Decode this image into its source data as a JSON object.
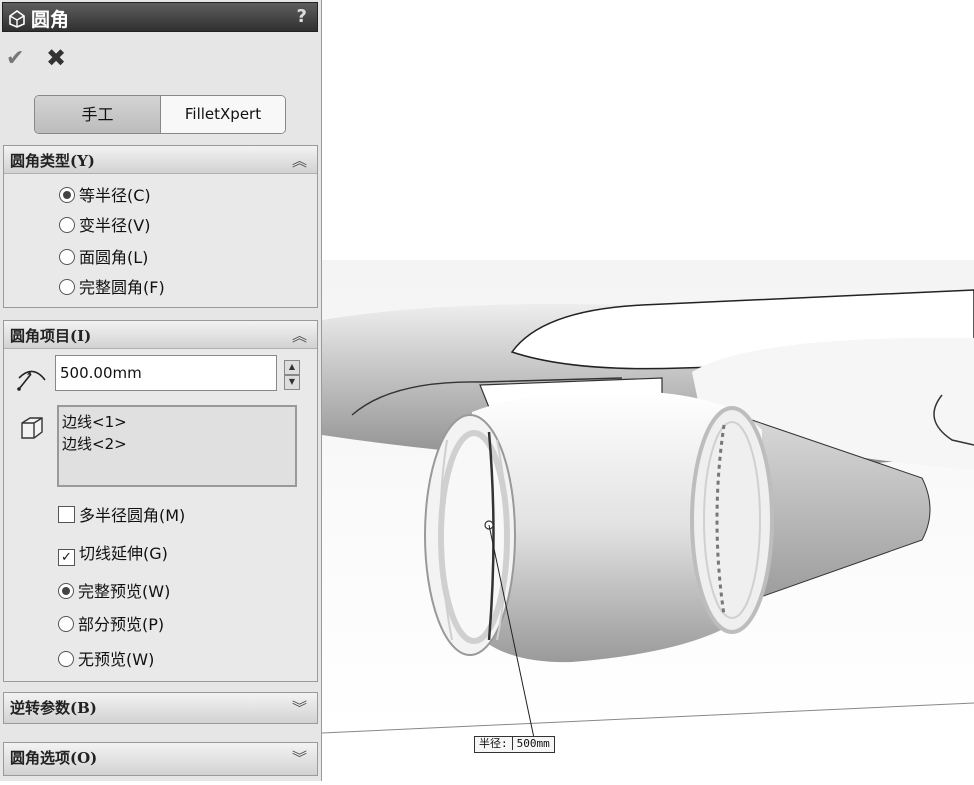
{
  "panel": {
    "title": "圆角",
    "help": "?",
    "tabs": {
      "manual": "手工",
      "filletxpert": "FilletXpert"
    },
    "fillet_type": {
      "header": "圆角类型(Y)",
      "options": [
        "等半径(C)",
        "变半径(V)",
        "面圆角(L)",
        "完整圆角(F)"
      ],
      "selected": 0
    },
    "fillet_items": {
      "header": "圆角项目(I)",
      "radius_value": "500.00mm",
      "edges": [
        "边线<1>",
        "边线<2>"
      ],
      "multi_radius": {
        "label": "多半径圆角(M)",
        "checked": false
      },
      "tangent_propagation": {
        "label": "切线延伸(G)",
        "checked": true
      },
      "preview_options": [
        "完整预览(W)",
        "部分预览(P)",
        "无预览(W)"
      ],
      "preview_selected": 0
    },
    "setback": {
      "header": "逆转参数(B)"
    },
    "fillet_options": {
      "header": "圆角选项(O)"
    }
  },
  "viewport": {
    "callout_label": "半径:",
    "callout_value": "500mm"
  }
}
